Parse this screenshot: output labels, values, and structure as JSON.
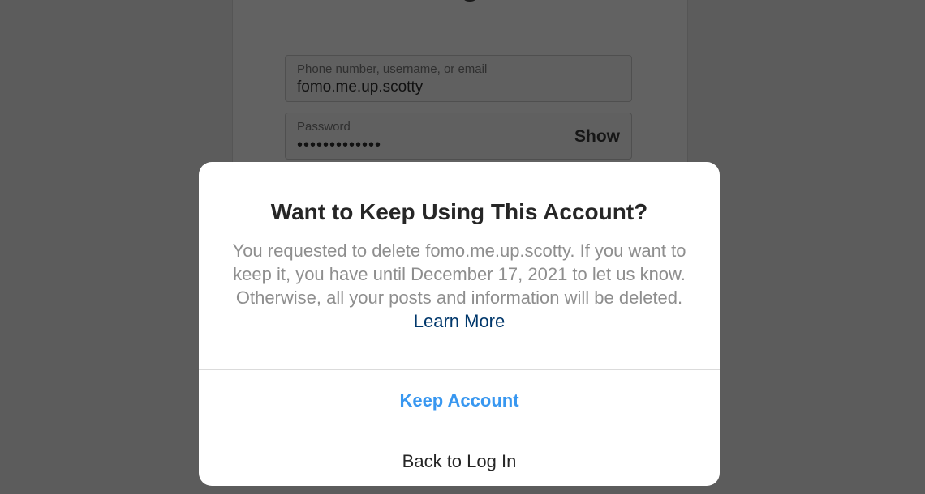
{
  "login": {
    "username_label": "Phone number, username, or email",
    "username_value": "fomo.me.up.scotty",
    "password_label": "Password",
    "password_value": "•••••••••••••",
    "show_label": "Show"
  },
  "modal": {
    "title": "Want to Keep Using This Account?",
    "body": "You requested to delete fomo.me.up.scotty. If you want to keep it, you have until December 17, 2021 to let us know. Otherwise, all your posts and information will be deleted.",
    "learn_more": "Learn More",
    "keep_button": "Keep Account",
    "back_button": "Back to Log In"
  },
  "colors": {
    "overlay": "#5c5c5c",
    "accent": "#3897f0",
    "link": "#00376b",
    "body_text": "#8e8e8e",
    "title_text": "#262626"
  }
}
